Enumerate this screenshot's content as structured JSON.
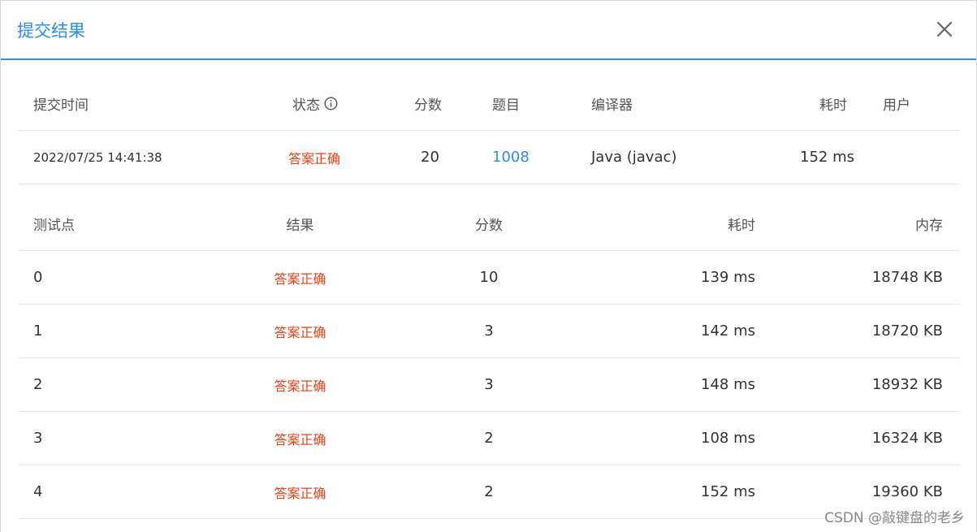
{
  "dialog": {
    "title": "提交结果",
    "close_icon": "close-icon"
  },
  "summary": {
    "headers": {
      "time": "提交时间",
      "status": "状态",
      "score": "分数",
      "problem": "题目",
      "compiler": "编译器",
      "cost": "耗时",
      "user": "用户"
    },
    "status_icon": "info-circle-icon",
    "row": {
      "time": "2022/07/25 14:41:38",
      "status": "答案正确",
      "score": "20",
      "problem": "1008",
      "compiler": "Java (javac)",
      "cost": "152 ms",
      "user": ""
    }
  },
  "cases": {
    "headers": {
      "id": "测试点",
      "result": "结果",
      "score": "分数",
      "cost": "耗时",
      "memory": "内存"
    },
    "rows": [
      {
        "id": "0",
        "result": "答案正确",
        "score": "10",
        "cost": "139 ms",
        "memory": "18748 KB"
      },
      {
        "id": "1",
        "result": "答案正确",
        "score": "3",
        "cost": "142 ms",
        "memory": "18720 KB"
      },
      {
        "id": "2",
        "result": "答案正确",
        "score": "3",
        "cost": "148 ms",
        "memory": "18932 KB"
      },
      {
        "id": "3",
        "result": "答案正确",
        "score": "2",
        "cost": "108 ms",
        "memory": "16324 KB"
      },
      {
        "id": "4",
        "result": "答案正确",
        "score": "2",
        "cost": "152 ms",
        "memory": "19360 KB"
      }
    ]
  },
  "colors": {
    "accent": "#2d8cf0",
    "success_text": "#ed4014"
  },
  "watermark": "CSDN @敲键盘的老乡"
}
